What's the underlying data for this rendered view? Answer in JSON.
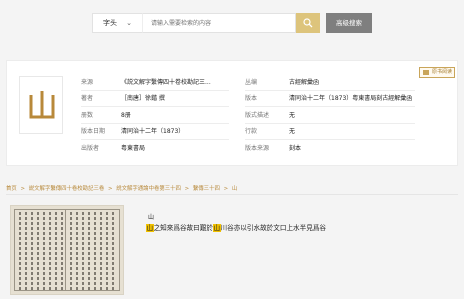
{
  "search": {
    "type_label": "字头",
    "placeholder": "请输入需要检索的内容",
    "advanced_label": "高级搜索"
  },
  "read_button_label": "原书阅读",
  "book_info": {
    "left": [
      {
        "key": "来源",
        "value": "《説文解字繫傳四十卷校勘記三..."
      },
      {
        "key": "著者",
        "value": "［南唐］徐鍇 撰"
      },
      {
        "key": "册数",
        "value": "8册"
      },
      {
        "key": "版本日期",
        "value": "清同治十二年（1873）"
      },
      {
        "key": "出版者",
        "value": "粤東書局"
      }
    ],
    "right": [
      {
        "key": "丛编",
        "value": "古經解彙函"
      },
      {
        "key": "版本",
        "value": "清同治十二年（1873）粤東書局刻古經解彙函"
      },
      {
        "key": "版式描述",
        "value": "无"
      },
      {
        "key": "行款",
        "value": "无"
      },
      {
        "key": "版本来源",
        "value": "刻本"
      }
    ]
  },
  "breadcrumb": [
    "首页",
    "説文解字繫傳四十卷校勘記三卷",
    "説文解字通論中卷第三十四",
    "繫傳三十四",
    "山"
  ],
  "entry": {
    "label": "山",
    "hl1": "山",
    "text1": "之知來爲谷故曰艱於",
    "hl2": "山",
    "text2": "川谷亦以引水故於文口上水半見爲谷"
  },
  "colors": {
    "accent": "#ddc47c",
    "highlight": "#f2c200",
    "link": "#b88a3c"
  }
}
